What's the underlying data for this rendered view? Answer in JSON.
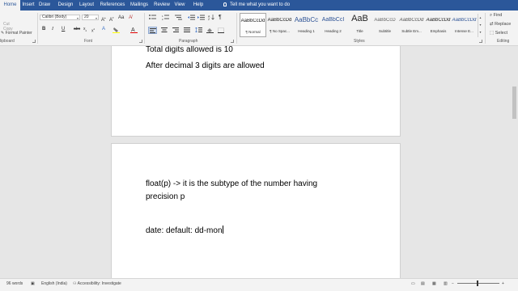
{
  "tabs": [
    "Home",
    "Insert",
    "Draw",
    "Design",
    "Layout",
    "References",
    "Mailings",
    "Review",
    "View",
    "Help"
  ],
  "tell_me": "Tell me what you want to do",
  "clipboard": {
    "cut": "Cut",
    "copy": "Copy",
    "format_painter": "Format Painter",
    "group": "lipboard"
  },
  "font": {
    "name": "Calibri (Body)",
    "size": "20",
    "group": "Font"
  },
  "paragraph": {
    "group": "Paragraph"
  },
  "styles": {
    "group": "Styles",
    "items": [
      {
        "sample": "AaBbCcDd",
        "name": "¶ Normal"
      },
      {
        "sample": "AaBbCcDd",
        "name": "¶ No Spac..."
      },
      {
        "sample": "AaBbCc",
        "name": "Heading 1"
      },
      {
        "sample": "AaBbCcI",
        "name": "Heading 2"
      },
      {
        "sample": "AaB",
        "name": "Title"
      },
      {
        "sample": "AaBbCcD",
        "name": "Subtitle"
      },
      {
        "sample": "AaBbCcDd",
        "name": "Subtle Em..."
      },
      {
        "sample": "AaBbCcDd",
        "name": "Emphasis"
      },
      {
        "sample": "AaBbCcDd",
        "name": "Intense E..."
      }
    ],
    "heading_color": "#2f5496"
  },
  "editing": {
    "find": "Find",
    "replace": "Replace",
    "select": "Select",
    "group": "Editing"
  },
  "document": {
    "page1_lines": [
      "Total digits allowed is 10",
      "After decimal 3 digits are allowed"
    ],
    "page2_lines": [
      "float(p) -> it is the subtype of the number having",
      "precision p",
      "date:  default: dd-mon"
    ]
  },
  "status": {
    "words": "96 words",
    "language": "English (India)",
    "accessibility": "Accessibility: Investigate"
  },
  "colors": {
    "ribbon_blue": "#2b579a",
    "highlight": "#ffff00",
    "font_color": "#e00000"
  },
  "icons": [
    "find-icon",
    "replace-icon",
    "select-icon",
    "bold-icon",
    "italic-icon",
    "underline-icon",
    "bulb-icon",
    "spelling-icon",
    "accessibility-icon"
  ]
}
